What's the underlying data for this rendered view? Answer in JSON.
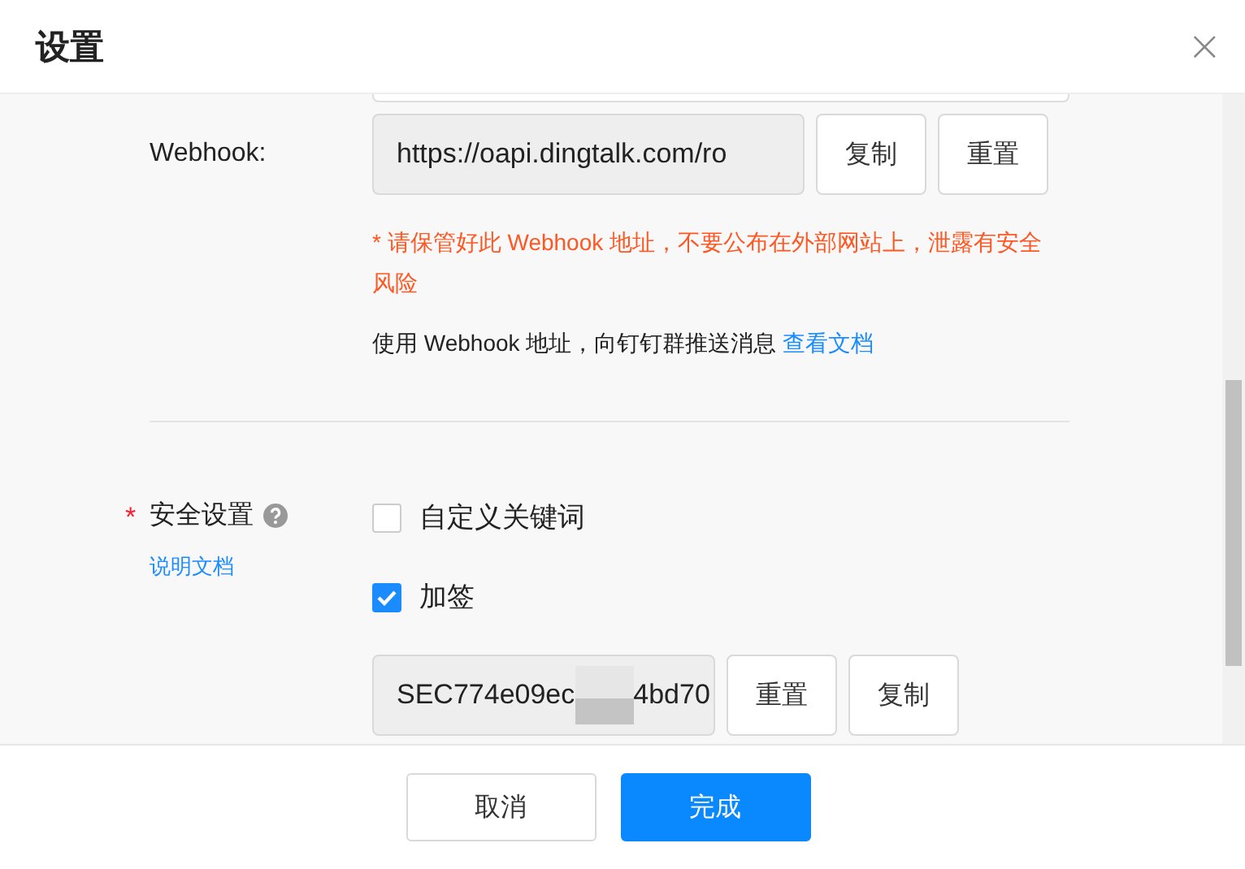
{
  "dialog": {
    "title": "设置",
    "close": "×"
  },
  "webhook": {
    "label": "Webhook:",
    "value": "https://oapi.dingtalk.com/ro",
    "buttons": [
      "复制",
      "重置"
    ],
    "warning": "* 请保管好此 Webhook 地址，不要公布在外部网站上，泄露有安全风险",
    "info": "使用 Webhook 地址，向钉钉群推送消息",
    "info_link": "查看文档"
  },
  "security": {
    "required_mark": "*",
    "label": "安全设置",
    "help_link": "说明文档",
    "options": [
      {
        "label": "自定义关键词",
        "checked": false
      },
      {
        "label": "加签",
        "checked": true
      }
    ],
    "secret": {
      "value_start": "SEC774e09ec",
      "value_end": "4bd70",
      "redacted": true
    },
    "buttons": [
      "重置",
      "复制"
    ]
  },
  "footer": {
    "buttons": [
      {
        "label": "取消",
        "kind": "default"
      },
      {
        "label": "完成",
        "kind": "primary"
      }
    ]
  }
}
